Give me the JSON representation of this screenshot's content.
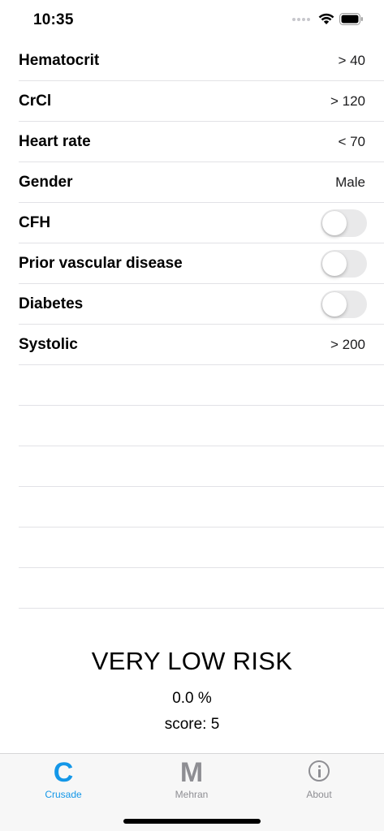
{
  "status_bar": {
    "time": "10:35",
    "icons": [
      "signal-icon",
      "wifi-icon",
      "battery-icon"
    ]
  },
  "parameters": [
    {
      "label": "Hematocrit",
      "value": "> 40"
    },
    {
      "label": "CrCl",
      "value": "> 120"
    },
    {
      "label": "Heart rate",
      "value": "< 70"
    },
    {
      "label": "Gender",
      "value": "Male"
    },
    {
      "label": "CFH",
      "toggle": false
    },
    {
      "label": "Prior vascular disease",
      "toggle": false
    },
    {
      "label": "Diabetes",
      "toggle": false
    },
    {
      "label": "Systolic",
      "value": "> 200"
    }
  ],
  "result": {
    "risk": "VERY LOW RISK",
    "percent": "0.0 %",
    "score": "score: 5"
  },
  "tab_bar": {
    "tabs": [
      {
        "label": "Crusade",
        "glyph": "C",
        "active": true
      },
      {
        "label": "Mehran",
        "glyph": "M",
        "active": false
      },
      {
        "label": "About",
        "icon": "info-icon",
        "active": false
      }
    ],
    "active_color": "#1497e8",
    "inactive_color": "#8e8e93"
  }
}
